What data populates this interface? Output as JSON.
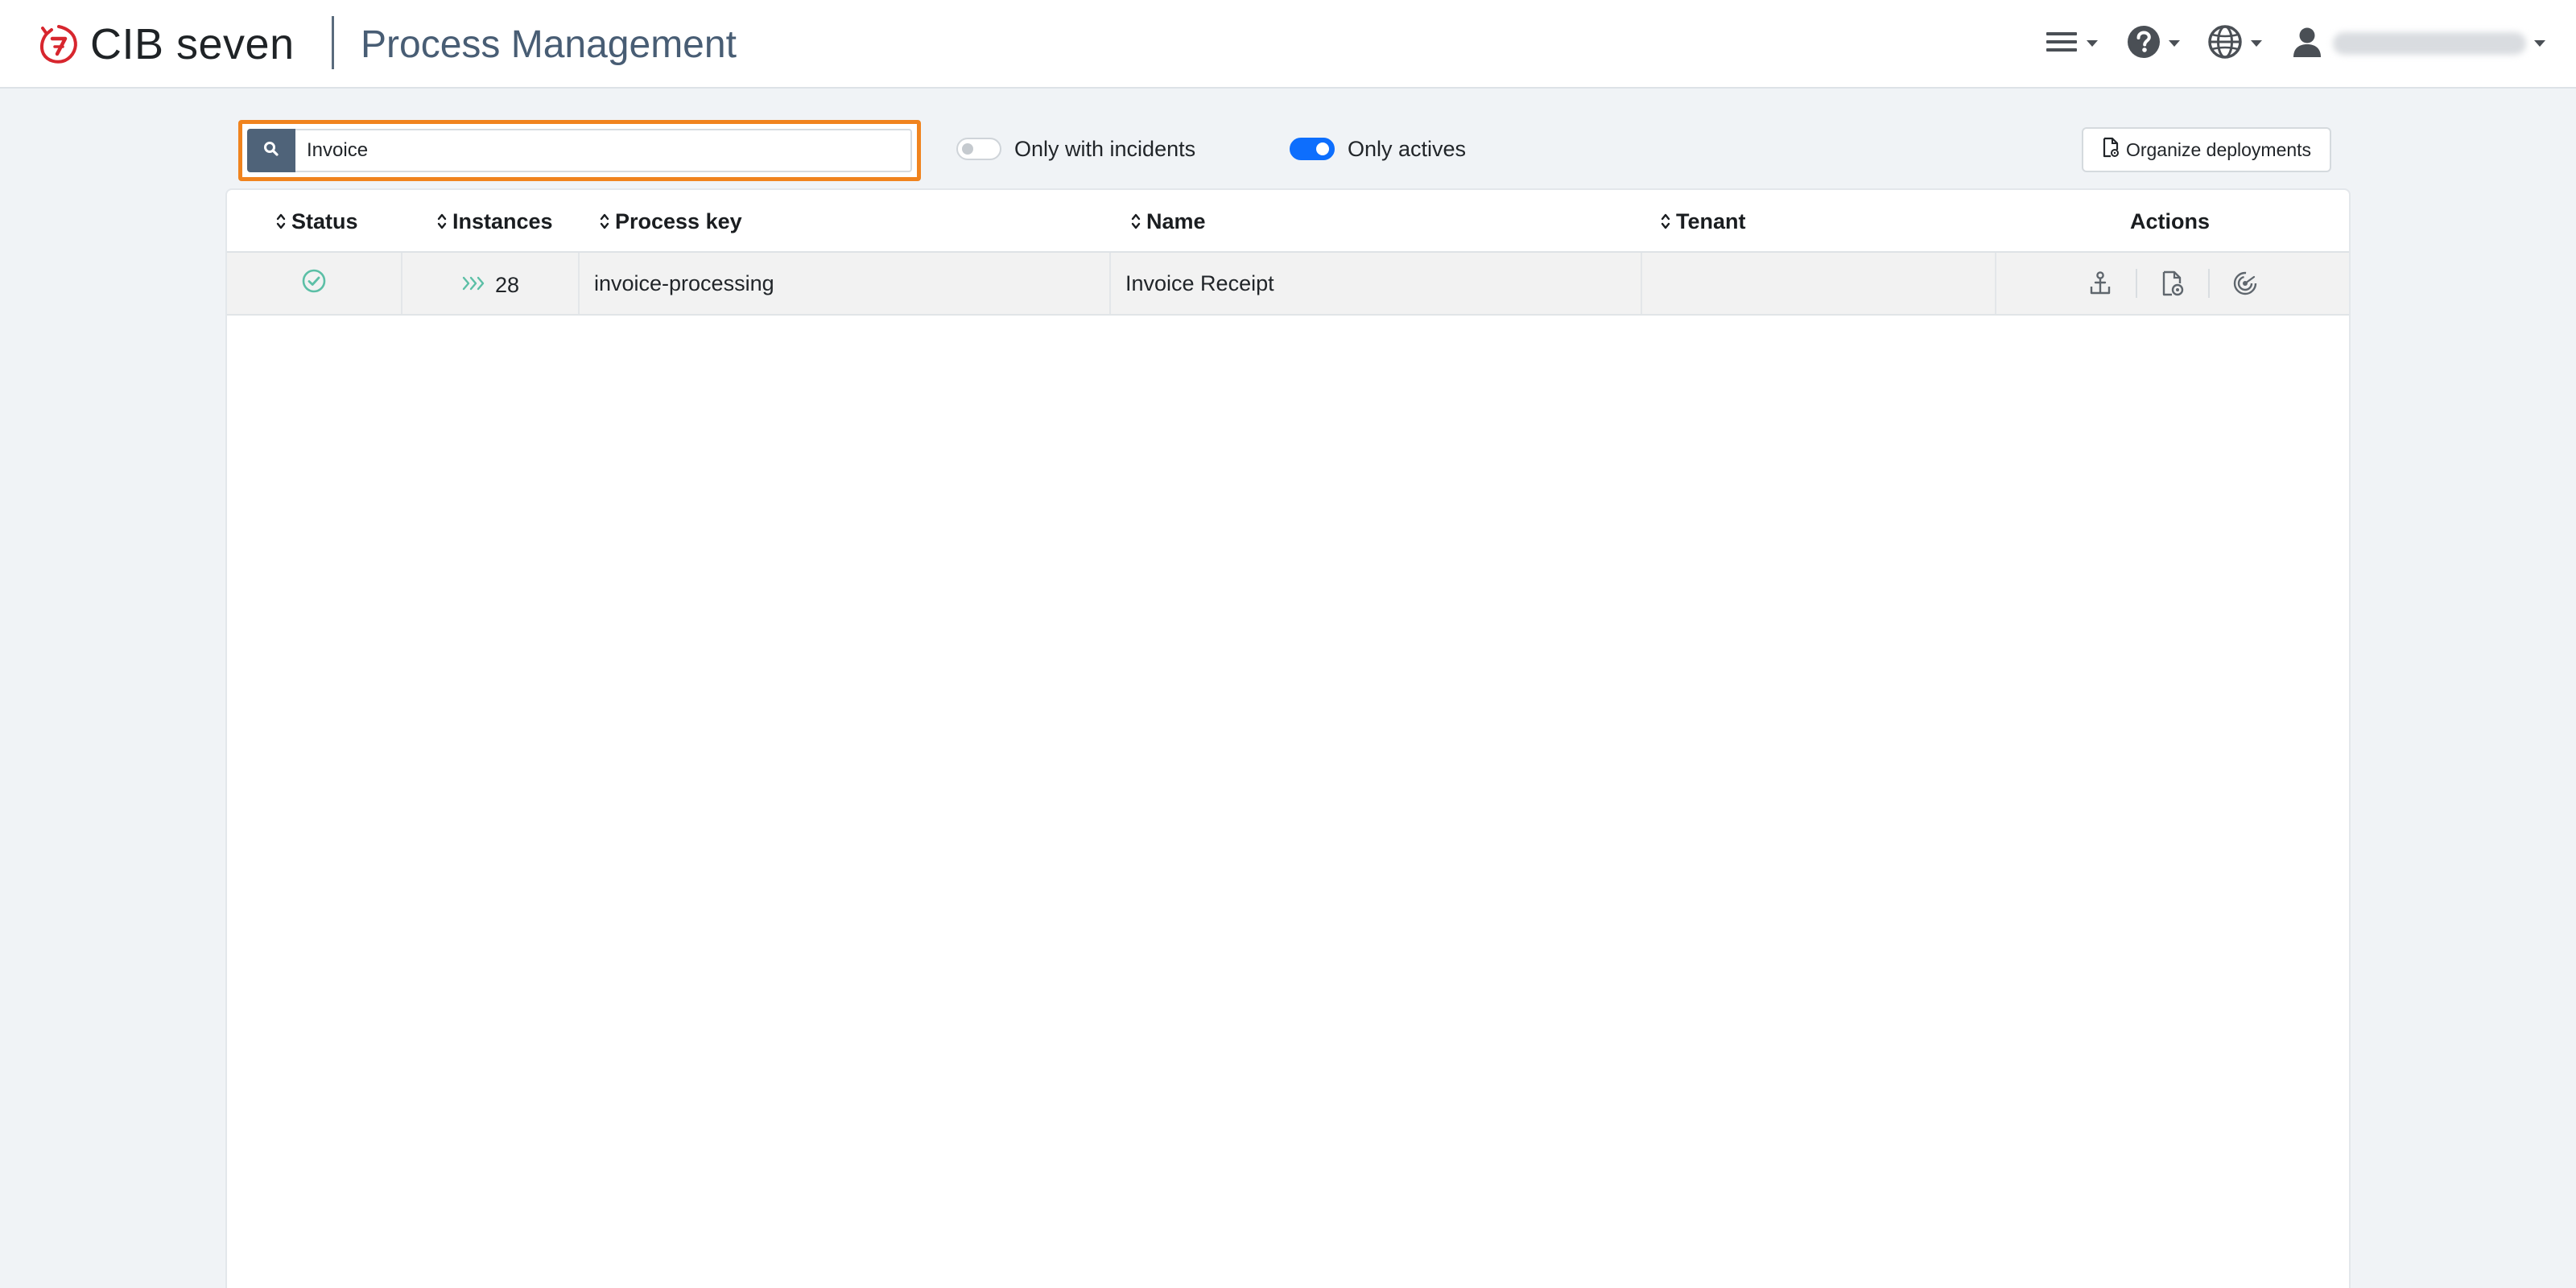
{
  "header": {
    "brand_name": "CIB seven",
    "app_title": "Process Management",
    "user_name": ""
  },
  "toolbar": {
    "search_value": "Invoice",
    "search_placeholder": "",
    "only_incidents_label": "Only with incidents",
    "only_incidents_on": false,
    "only_actives_label": "Only actives",
    "only_actives_on": true,
    "organize_label": "Organize deployments"
  },
  "table": {
    "columns": {
      "status": "Status",
      "instances": "Instances",
      "process_key": "Process key",
      "name": "Name",
      "tenant": "Tenant",
      "actions": "Actions"
    },
    "rows": [
      {
        "status_icon": "check-circle-icon",
        "instances": "28",
        "process_key": "invoice-processing",
        "name": "Invoice Receipt",
        "tenant": ""
      }
    ]
  },
  "colors": {
    "accent": "#0d6efd",
    "search_highlight": "#f0831e",
    "search_button": "#4f6379",
    "title": "#485d74",
    "status_ok": "#5cbfa6",
    "brand_red": "#d7262e"
  },
  "icons": {
    "menu": "hamburger-icon",
    "help": "help-circle-icon",
    "language": "globe-icon",
    "user": "user-icon",
    "action_1": "anchor-icon",
    "action_2": "file-view-icon",
    "action_3": "radar-icon"
  }
}
